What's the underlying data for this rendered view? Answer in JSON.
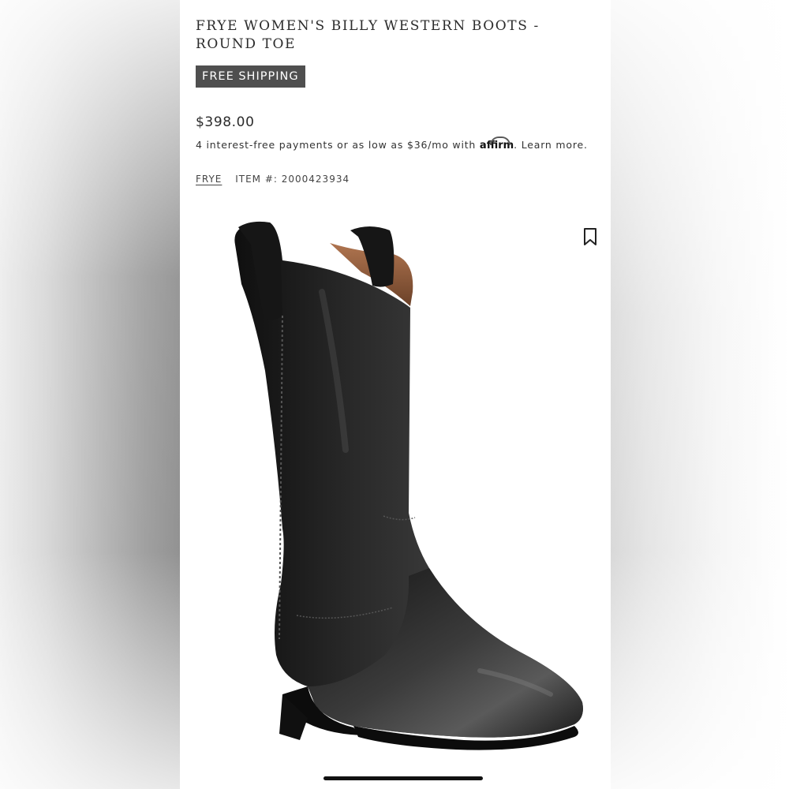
{
  "product": {
    "title": "FRYE WOMEN'S BILLY WESTERN BOOTS - ROUND TOE",
    "badge": "FREE SHIPPING",
    "price": "$398.00",
    "financing": {
      "prefix": "4 interest-free payments or as low as $36/mo with",
      "provider_logo_text": "affirm",
      "suffix": ".",
      "learn_more": "Learn more."
    },
    "brand": "FRYE",
    "item_number": "ITEM #: 2000423934"
  },
  "icons": {
    "bookmark": "bookmark-icon"
  },
  "colors": {
    "badge_bg": "#4f4f4f",
    "text": "#2b2b2b",
    "boot": "#1f1f1f",
    "boot_lining": "#8a5a3c"
  }
}
